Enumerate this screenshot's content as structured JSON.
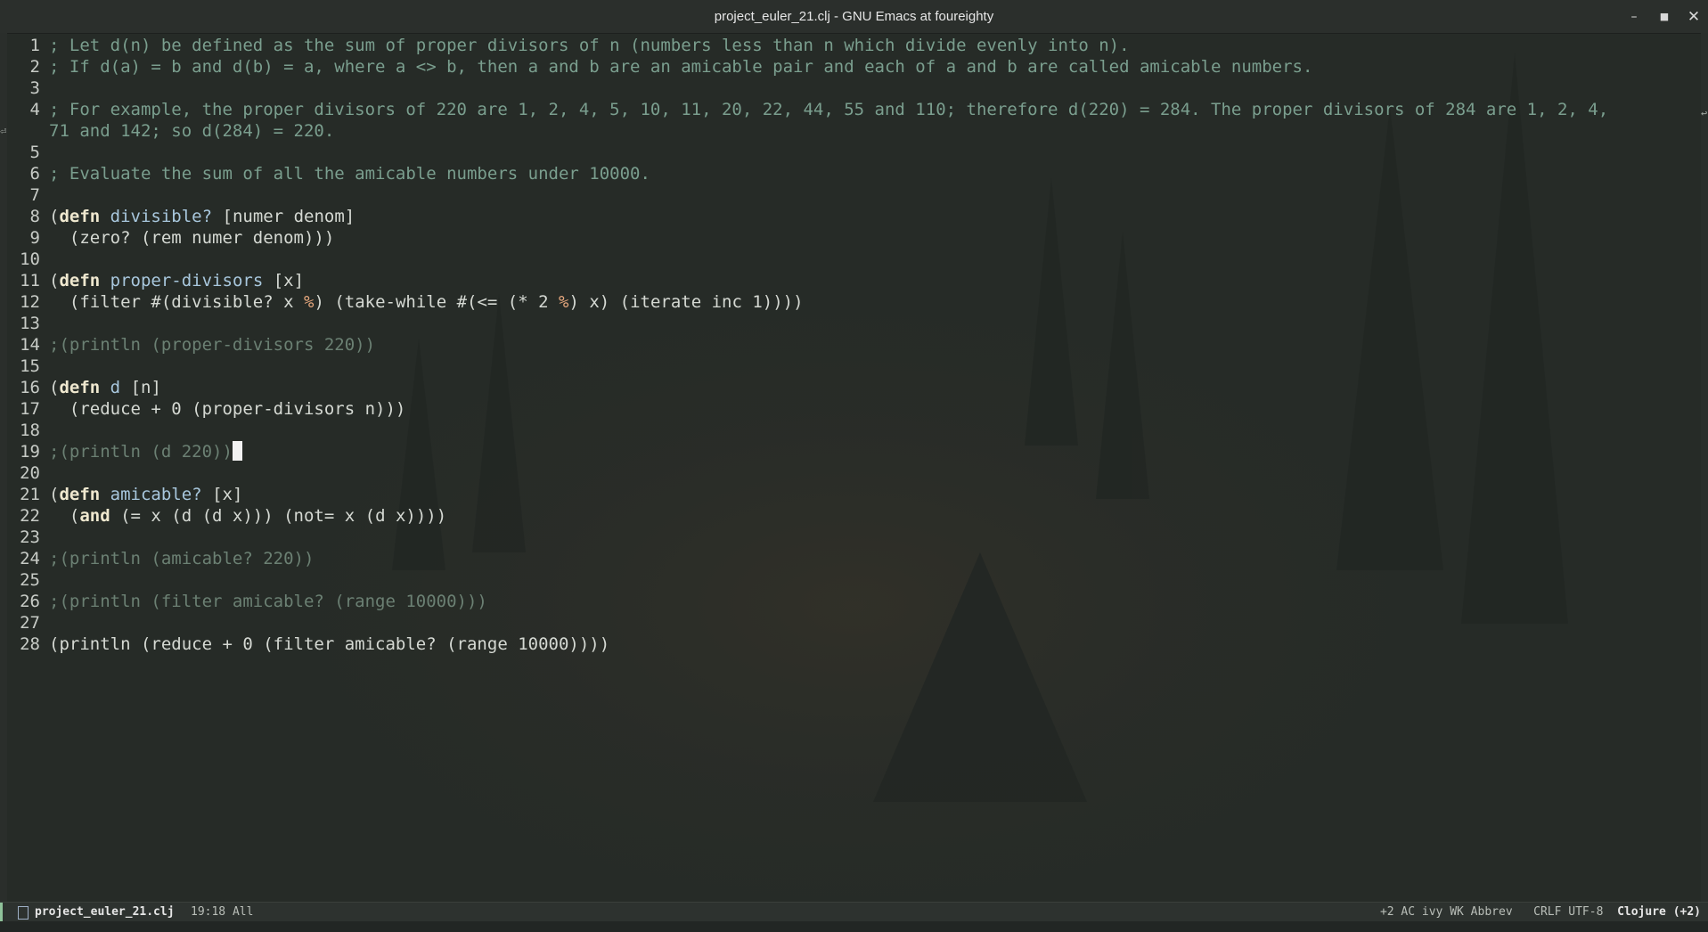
{
  "window": {
    "title": "project_euler_21.clj - GNU Emacs at foureighty",
    "minimize_glyph": "–",
    "maximize_glyph": "■",
    "close_glyph": "✕"
  },
  "editor": {
    "lines": [
      {
        "n": "1",
        "text": "; Let d(n) be defined as the sum of proper divisors of n (numbers less than n which divide evenly into n)."
      },
      {
        "n": "2",
        "text": "; If d(a) = b and d(b) = a, where a <> b, then a and b are an amicable pair and each of a and b are called amicable numbers."
      },
      {
        "n": "3",
        "text": ""
      },
      {
        "n": "4",
        "text": "; For example, the proper divisors of 220 are 1, 2, 4, 5, 10, 11, 20, 22, 44, 55 and 110; therefore d(220) = 284. The proper divisors of 284 are 1, 2, 4,"
      },
      {
        "n": "",
        "text": "71 and 142; so d(284) = 220."
      },
      {
        "n": "5",
        "text": ""
      },
      {
        "n": "6",
        "text": "; Evaluate the sum of all the amicable numbers under 10000."
      },
      {
        "n": "7",
        "text": ""
      },
      {
        "n": "8",
        "text": "(defn divisible? [numer denom]"
      },
      {
        "n": "9",
        "text": "  (zero? (rem numer denom)))"
      },
      {
        "n": "10",
        "text": ""
      },
      {
        "n": "11",
        "text": "(defn proper-divisors [x]"
      },
      {
        "n": "12",
        "text": "  (filter #(divisible? x %) (take-while #(<= (* 2 %) x) (iterate inc 1))))"
      },
      {
        "n": "13",
        "text": ""
      },
      {
        "n": "14",
        "text": ";(println (proper-divisors 220))"
      },
      {
        "n": "15",
        "text": ""
      },
      {
        "n": "16",
        "text": "(defn d [n]"
      },
      {
        "n": "17",
        "text": "  (reduce + 0 (proper-divisors n)))"
      },
      {
        "n": "18",
        "text": ""
      },
      {
        "n": "19",
        "text": ";(println (d 220))"
      },
      {
        "n": "20",
        "text": ""
      },
      {
        "n": "21",
        "text": "(defn amicable? [x]"
      },
      {
        "n": "22",
        "text": "  (and (= x (d (d x))) (not= x (d x))))"
      },
      {
        "n": "23",
        "text": ""
      },
      {
        "n": "24",
        "text": ";(println (amicable? 220))"
      },
      {
        "n": "25",
        "text": ""
      },
      {
        "n": "26",
        "text": ";(println (filter amicable? (range 10000)))"
      },
      {
        "n": "27",
        "text": ""
      },
      {
        "n": "28",
        "text": "(println (reduce + 0 (filter amicable? (range 10000))))"
      }
    ]
  },
  "modeline": {
    "buffer_name": "project_euler_21.clj",
    "position": "19:18 All",
    "minor_modes": "+2 AC ivy WK Abbrev",
    "encoding": "CRLF UTF-8",
    "major_mode": "Clojure (+2)"
  },
  "colors": {
    "background": "#262b27",
    "comment": "#7a9e8e",
    "keyword": "#efe8cf",
    "function_name": "#a8c7dd",
    "modeline_accent": "#8fc29a"
  }
}
